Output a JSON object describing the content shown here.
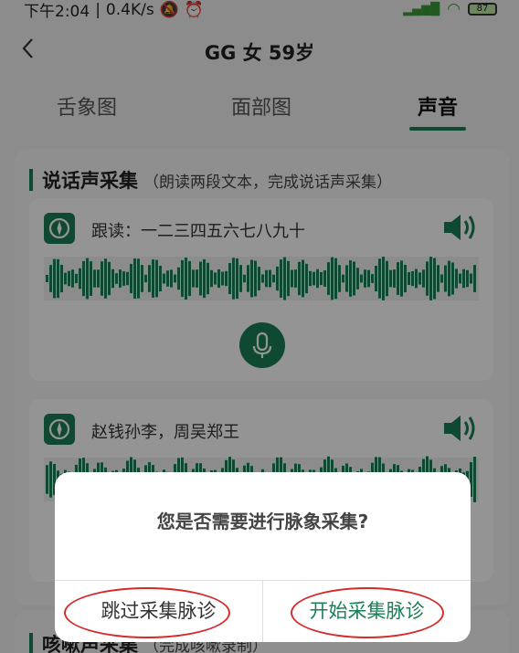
{
  "status_bar": {
    "time": "下午2:04",
    "speed": "0.4K/s",
    "battery": "87"
  },
  "header": {
    "title": "GG 女 59岁"
  },
  "tabs": [
    {
      "label": "舌象图"
    },
    {
      "label": "面部图"
    },
    {
      "label": "声音"
    }
  ],
  "section": {
    "title": "说话声采集",
    "subtitle": "（朗读两段文本，完成说话声采集）"
  },
  "cards": [
    {
      "text": "跟读：一二三四五六七八九十"
    },
    {
      "text": "赵钱孙李，周吴郑王"
    }
  ],
  "section2": {
    "title": "咳嗽声采集",
    "subtitle": "（完成咳嗽录制）"
  },
  "dialog": {
    "message": "您是否需要进行脉象采集?",
    "skip_label": "跳过采集脉诊",
    "start_label": "开始采集脉诊"
  },
  "colors": {
    "accent": "#1a7f55",
    "annotation": "#d42a2a"
  }
}
